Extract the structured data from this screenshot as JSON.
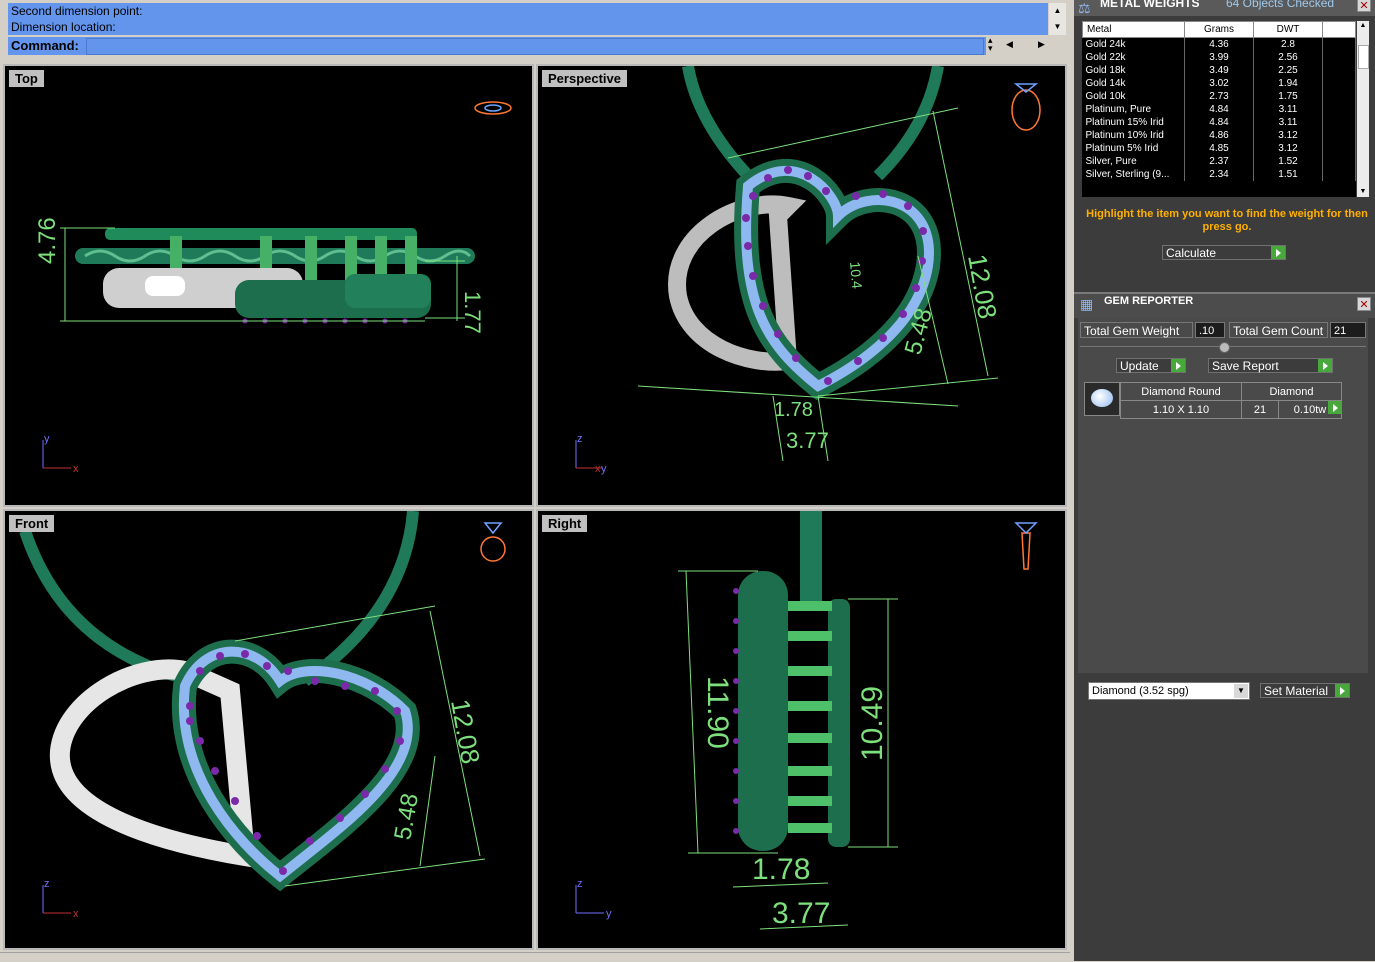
{
  "command_area": {
    "history_lines": [
      "Second dimension point:",
      "Dimension location:"
    ],
    "command_label": "Command:",
    "command_value": ""
  },
  "viewports": {
    "top": {
      "title": "Top",
      "axis_labels": [
        "y",
        "x"
      ],
      "dimensions": [
        "4.76",
        "1.77"
      ]
    },
    "perspective": {
      "title": "Perspective",
      "axis_labels": [
        "z",
        "x",
        "y"
      ],
      "dimensions": [
        "12.08",
        "5.48",
        "1.78",
        "3.77",
        "10.4"
      ]
    },
    "front": {
      "title": "Front",
      "axis_labels": [
        "z",
        "x"
      ],
      "dimensions": [
        "12.08",
        "5.48"
      ]
    },
    "right": {
      "title": "Right",
      "axis_labels": [
        "z",
        "y"
      ],
      "dimensions": [
        "11.90",
        "10.49",
        "1.78",
        "3.77"
      ]
    }
  },
  "metal_weights": {
    "title": "METAL WEIGHTS",
    "objects_checked": "64 Objects Checked",
    "columns": [
      "Metal",
      "Grams",
      "DWT"
    ],
    "rows": [
      [
        "Gold 24k",
        "4.36",
        "2.8"
      ],
      [
        "Gold 22k",
        "3.99",
        "2.56"
      ],
      [
        "Gold 18k",
        "3.49",
        "2.25"
      ],
      [
        "Gold 14k",
        "3.02",
        "1.94"
      ],
      [
        "Gold 10k",
        "2.73",
        "1.75"
      ],
      [
        "Platinum, Pure",
        "4.84",
        "3.11"
      ],
      [
        "Platinum 15% Irid",
        "4.84",
        "3.11"
      ],
      [
        "Platinum 10% Irid",
        "4.86",
        "3.12"
      ],
      [
        "Platinum 5% Irid",
        "4.85",
        "3.12"
      ],
      [
        "Silver, Pure",
        "2.37",
        "1.52"
      ],
      [
        "Silver, Sterling (9...",
        "2.34",
        "1.51"
      ]
    ],
    "hint": "Highlight the item you want to find the weight for then press go.",
    "calculate_label": "Calculate"
  },
  "gem_reporter": {
    "title": "GEM REPORTER",
    "total_weight_label": "Total Gem Weight",
    "total_weight_value": ".10",
    "total_count_label": "Total Gem Count",
    "total_count_value": "21",
    "update_label": "Update",
    "save_report_label": "Save Report",
    "gem_row": {
      "shape_header": "Diamond Round",
      "type_header": "Diamond",
      "size": "1.10 X 1.10",
      "count": "21",
      "weight": "0.10tw"
    }
  },
  "material": {
    "selected": "Diamond    (3.52 spg)",
    "set_material_label": "Set Material"
  },
  "colors": {
    "cmd_blue": "#6495ed",
    "green_metal": "#1f7a5a",
    "dimension_green": "#7de07d",
    "gem_purple": "#7a2aa8",
    "gem_blue": "#8fb8f0",
    "hint_orange": "#ffb000"
  }
}
